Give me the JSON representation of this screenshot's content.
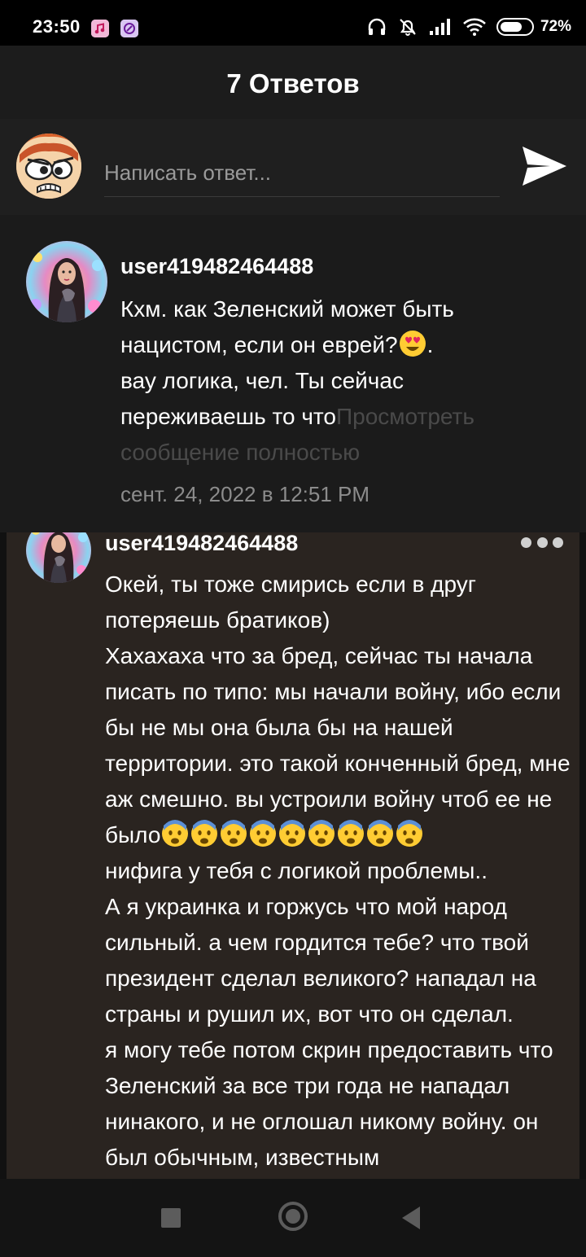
{
  "status_bar": {
    "time": "23:50",
    "battery_percent": 72,
    "battery_label": "72%",
    "icons": [
      "music-app-icon",
      "browser-app-icon",
      "headphones-icon",
      "bell-muted-icon",
      "signal-icon",
      "wifi-icon",
      "battery-icon"
    ]
  },
  "header": {
    "title": "7 Ответов"
  },
  "reply_bar": {
    "placeholder": "Написать ответ...",
    "send_icon": "send-icon"
  },
  "post": {
    "username": "user419482464488",
    "text": "Кхм. как Зеленский может быть нацистом, если он еврей?",
    "emoji": "heart-eyes-emoji",
    "text_after_emoji": ".",
    "text_line2": "вау логика, чел. Ты сейчас переживаешь то что",
    "view_more": "Просмотреть сообщение полностью",
    "date": "сент. 24, 2022 в 12:51 PM"
  },
  "reply": {
    "username": "user419482464488",
    "menu_icon": "more-options-icon",
    "text_part1": "Окей, ты тоже смирись если в друг потеряешь братиков)\nХахахаха что за бред, сейчас ты начала писать по типо: мы начали войну, ибо если бы не мы она была бы на нашей территории. это такой конченный бред, мне аж смешно. вы устроили войну чтоб ее не было",
    "emoji": "fearful-face-emoji",
    "emoji_count": 9,
    "text_part2": "\nнифига у тебя с логикой проблемы..\nА я украинка и горжусь что мой народ сильный. а чем гордится тебе? что твой президент сделал великого? нападал на страны и рушил их, вот что он сделал.\nя могу тебе потом скрин предоставить что Зеленский за все три года не нападал нинакого, и не оглошал никому войну. он был обычным, известным"
  },
  "nav_bar": {
    "buttons": [
      "recents-button",
      "home-button",
      "back-button"
    ]
  },
  "colors": {
    "status_bg": "#000000",
    "header_bg": "#1c1c1c",
    "post_bg": "#1b1b1b",
    "reply_bg": "#2a2420",
    "muted_text": "#8c8c8c"
  }
}
